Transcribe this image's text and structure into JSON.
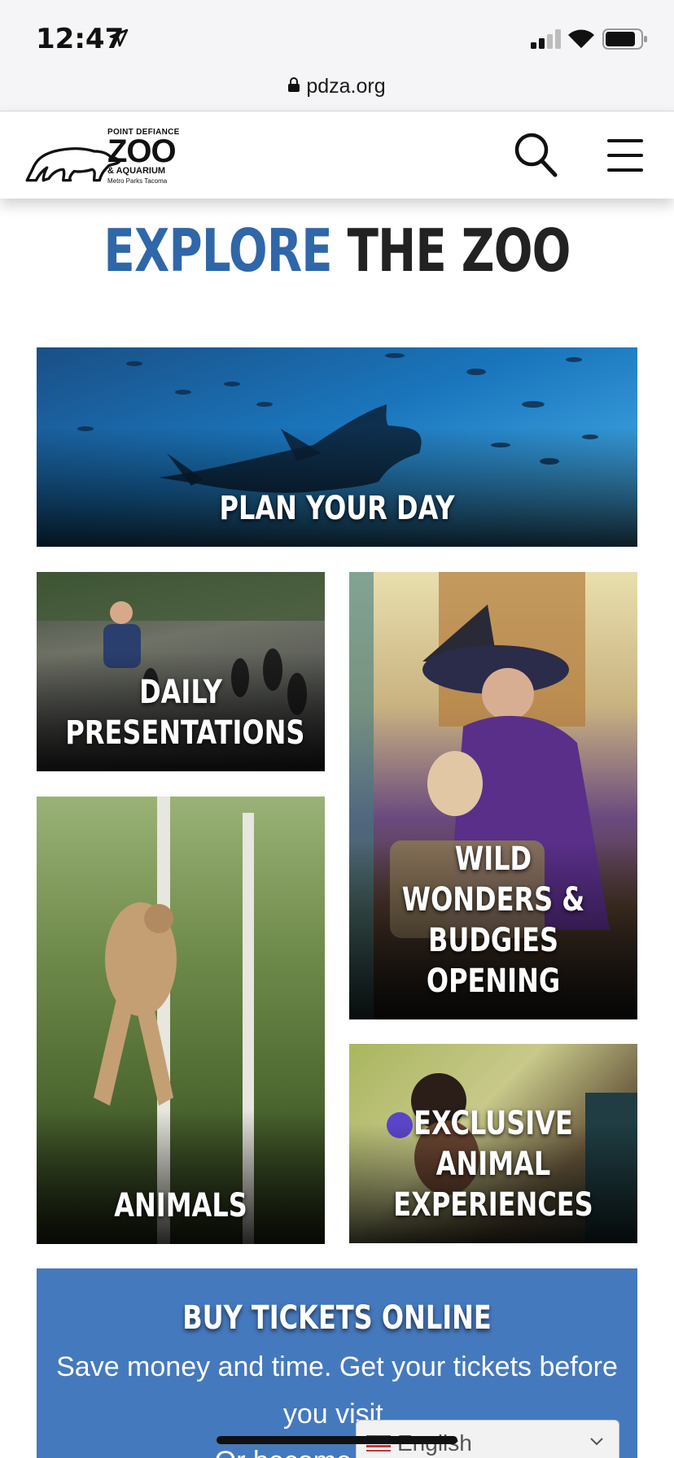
{
  "status_bar": {
    "time": "12:47"
  },
  "browser": {
    "url": "pdza.org"
  },
  "header": {
    "logo": {
      "line1": "POINT DEFIANCE",
      "line2": "ZOO",
      "line3": "& AQUARIUM",
      "line4": "Metro Parks Tacoma"
    },
    "search_icon": "search-icon",
    "menu_icon": "hamburger-menu-icon"
  },
  "heading": {
    "part1": "EXPLORE",
    "part2": "THE ZOO"
  },
  "tiles": [
    {
      "label": "PLAN YOUR DAY"
    },
    {
      "label_line1": "DAILY",
      "label_line2": "PRESENTATIONS"
    },
    {
      "label_line1": "WILD WONDERS &",
      "label_line2": "BUDGIES OPENING"
    },
    {
      "label": "ANIMALS"
    },
    {
      "label_line1": "EXCLUSIVE ANIMAL",
      "label_line2": "EXPERIENCES"
    }
  ],
  "tickets": {
    "title": "BUY TICKETS ONLINE",
    "description": "Save money and time. Get your tickets before you visit.",
    "description_cont": "Or become a memb"
  },
  "language": {
    "selected": "English"
  },
  "colors": {
    "brand_blue": "#2f67a8",
    "tickets_bg": "#4579bd",
    "heading_dark": "#222222"
  }
}
